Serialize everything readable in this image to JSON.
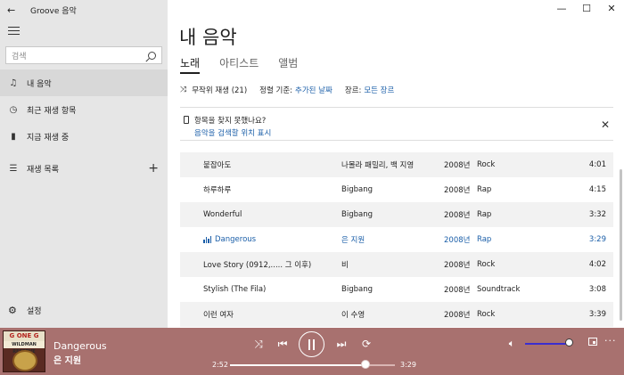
{
  "app": {
    "title": "Groove 음악"
  },
  "sidebar": {
    "search_placeholder": "검색",
    "items": [
      {
        "label": "내 음악",
        "icon": "music-note-icon"
      },
      {
        "label": "최근 재생 항목",
        "icon": "clock-icon"
      },
      {
        "label": "지금 재생 중",
        "icon": "equalizer-icon"
      },
      {
        "label": "재생 목록",
        "icon": "playlist-icon"
      }
    ],
    "settings_label": "설정"
  },
  "main": {
    "title": "내 음악",
    "tabs": [
      {
        "label": "노래"
      },
      {
        "label": "아티스트"
      },
      {
        "label": "앨범"
      }
    ],
    "filters": {
      "shuffle_label": "무작위 재생 (21)",
      "sort_label": "정렬 기준:",
      "sort_value": "추가된 날짜",
      "genre_label": "장르:",
      "genre_value": "모든 장르"
    },
    "notice": {
      "question": "항목을 찾지 못했나요?",
      "link": "음악을 검색할 위치 표시"
    },
    "songs": [
      {
        "title": "붙잡아도",
        "artist": "나몰라 패밀리, 백 지영",
        "year": "2008년",
        "genre": "Rock",
        "duration": "4:01"
      },
      {
        "title": "하루하루",
        "artist": "Bigbang",
        "year": "2008년",
        "genre": "Rap",
        "duration": "4:15"
      },
      {
        "title": "Wonderful",
        "artist": "Bigbang",
        "year": "2008년",
        "genre": "Rap",
        "duration": "3:32"
      },
      {
        "title": "Dangerous",
        "artist": "은 지원",
        "year": "2008년",
        "genre": "Rap",
        "duration": "3:29",
        "playing": true
      },
      {
        "title": "Love Story (0912,..... 그 이후)",
        "artist": "비",
        "year": "2008년",
        "genre": "Rock",
        "duration": "4:02"
      },
      {
        "title": "Stylish (The Fila)",
        "artist": "Bigbang",
        "year": "2008년",
        "genre": "Soundtrack",
        "duration": "3:08"
      },
      {
        "title": "이런 여자",
        "artist": "이 수영",
        "year": "2008년",
        "genre": "Rock",
        "duration": "3:39"
      }
    ]
  },
  "player": {
    "title": "Dangerous",
    "artist": "은 지원",
    "album_art_text_1": "G ONE G CODE",
    "album_art_text_2": "WILDMAN RESERVE",
    "elapsed": "2:52",
    "total": "3:29",
    "progress_fraction": 0.82,
    "volume_fraction": 0.98
  },
  "colors": {
    "accent": "#1a5ea8",
    "player_bg": "#a8716f",
    "sidebar_bg": "#e6e6e6",
    "volume": "#3b2ed0"
  }
}
